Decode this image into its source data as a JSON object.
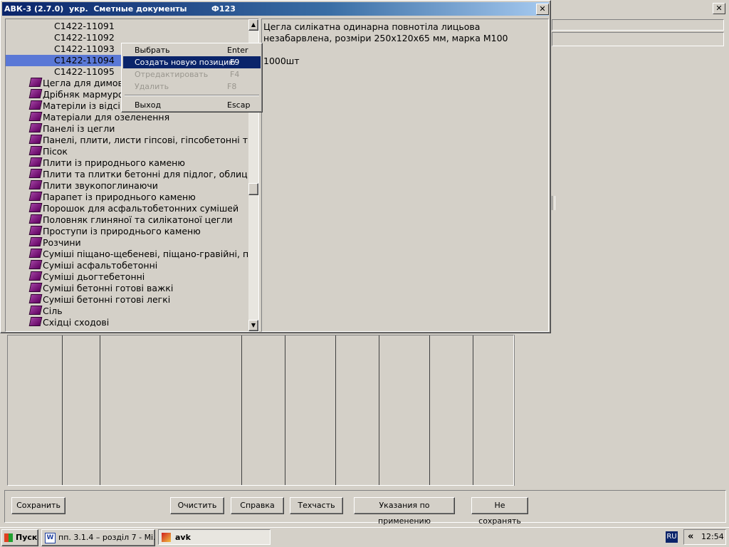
{
  "main_window": {
    "title": "АВК-3 (2.7.0)  укр.  Сметные документы         Ф123"
  },
  "tree": {
    "items": [
      {
        "label": "С1422-11091",
        "kind": "code"
      },
      {
        "label": "С1422-11092",
        "kind": "code"
      },
      {
        "label": "С1422-11093",
        "kind": "code"
      },
      {
        "label": "С1422-11094",
        "kind": "code",
        "selected": true
      },
      {
        "label": "С1422-11095",
        "kind": "code"
      },
      {
        "label": "Цегла для димови",
        "kind": "folder"
      },
      {
        "label": "Дрібняк мармуро",
        "kind": "folder"
      },
      {
        "label": "Матеріли із відсів",
        "kind": "folder"
      },
      {
        "label": "Матеріали для озеленення",
        "kind": "folder"
      },
      {
        "label": "Панелі із цегли",
        "kind": "folder"
      },
      {
        "label": "Панелі, плити, листи гіпсові, гіпсобетонні та",
        "kind": "folder"
      },
      {
        "label": "Пісок",
        "kind": "folder"
      },
      {
        "label": "Плити із природнього каменю",
        "kind": "folder"
      },
      {
        "label": "Плити та плитки бетонні для підлог, облицю",
        "kind": "folder"
      },
      {
        "label": "Плити звукопоглинаючи",
        "kind": "folder"
      },
      {
        "label": "Парапет із природнього каменю",
        "kind": "folder"
      },
      {
        "label": "Порошок для асфальтобетонних сумішей",
        "kind": "folder"
      },
      {
        "label": "Половняк глиняної та силікатоної цегли",
        "kind": "folder"
      },
      {
        "label": "Проступи із природнього каменю",
        "kind": "folder"
      },
      {
        "label": "Розчини",
        "kind": "folder"
      },
      {
        "label": "Суміші піщано-щебеневі, піщано-гравійні, піщ",
        "kind": "folder"
      },
      {
        "label": "Суміші асфальтобетонні",
        "kind": "folder"
      },
      {
        "label": "Суміші дьогтебетонні",
        "kind": "folder"
      },
      {
        "label": "Суміші бетонні готові важкі",
        "kind": "folder"
      },
      {
        "label": "Суміші бетонні готові легкі",
        "kind": "folder"
      },
      {
        "label": "Сіль",
        "kind": "folder"
      },
      {
        "label": "Східці сходові",
        "kind": "folder"
      }
    ]
  },
  "detail": {
    "line1": "Цегла силікатна одинарна повнотіла лицьова",
    "line2": "незабарвлена, розміри 250х120х65 мм, марка М100",
    "unit": "1000шт"
  },
  "context_menu": {
    "items": [
      {
        "label": "Выбрать",
        "key": "Enter",
        "state": "normal"
      },
      {
        "label": "Создать новую позицию",
        "key": "F9",
        "state": "highlighted"
      },
      {
        "label": "Отредактировать",
        "key": "F4",
        "state": "disabled"
      },
      {
        "label": "Удалить",
        "key": "F8",
        "state": "disabled"
      },
      {
        "label": "Выход",
        "key": "Escap",
        "state": "normal"
      }
    ]
  },
  "buttons": {
    "save": "Сохранить",
    "clear": "Очистить",
    "help": "Справка",
    "techpart": "Техчасть",
    "instructions": "Указания по применению",
    "dont_save": "Не сохранять"
  },
  "taskbar": {
    "start": "Пуск",
    "tasks": [
      {
        "label": "пп. 3.1.4 – розділ 7 - Mi...",
        "icon": "word-icon",
        "active": false
      },
      {
        "label": "avk",
        "icon": "avk-icon",
        "active": true
      }
    ],
    "lang": "RU",
    "tray_arrow": "«",
    "clock": "12:54"
  },
  "icons": {
    "close": "close-icon",
    "scroll_up": "scroll-up-arrow-icon",
    "scroll_down": "scroll-down-arrow-icon",
    "tree_item": "book-icon",
    "start": "windows-logo-icon"
  },
  "colors": {
    "title_active": "#0a246a",
    "selection": "#0a246a",
    "tree_highlight": "#5a78d6",
    "face": "#d4d0c8",
    "window_bg": "#ffffff"
  }
}
